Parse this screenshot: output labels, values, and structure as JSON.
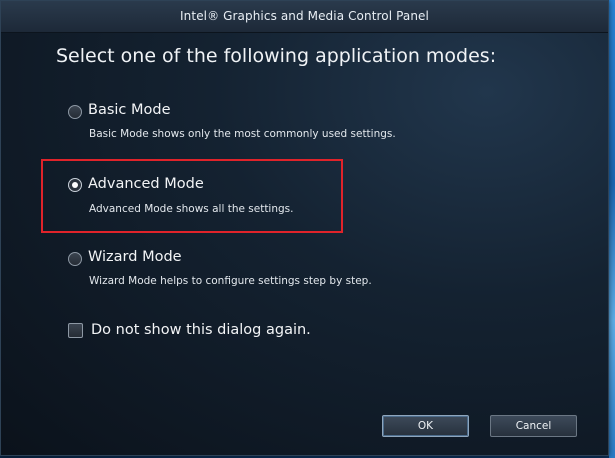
{
  "window": {
    "title": "Intel® Graphics and Media Control Panel"
  },
  "heading": "Select one of the following application modes:",
  "modes": [
    {
      "label": "Basic Mode",
      "description": "Basic Mode shows only the most commonly used settings.",
      "selected": false
    },
    {
      "label": "Advanced Mode",
      "description": "Advanced Mode shows all the settings.",
      "selected": true
    },
    {
      "label": "Wizard Mode",
      "description": "Wizard Mode helps to configure settings step by step.",
      "selected": false
    }
  ],
  "dont_show": {
    "label": "Do not show this dialog again.",
    "checked": false
  },
  "buttons": {
    "ok_label": "OK",
    "cancel_label": "Cancel"
  },
  "colors": {
    "highlight_border": "#e0232a",
    "dialog_background": "#142231",
    "text": "#f0f3f6"
  },
  "icons": {
    "radio_checked": "radio-checked-icon",
    "radio_unchecked": "radio-unchecked-icon",
    "checkbox_unchecked": "checkbox-unchecked-icon"
  }
}
